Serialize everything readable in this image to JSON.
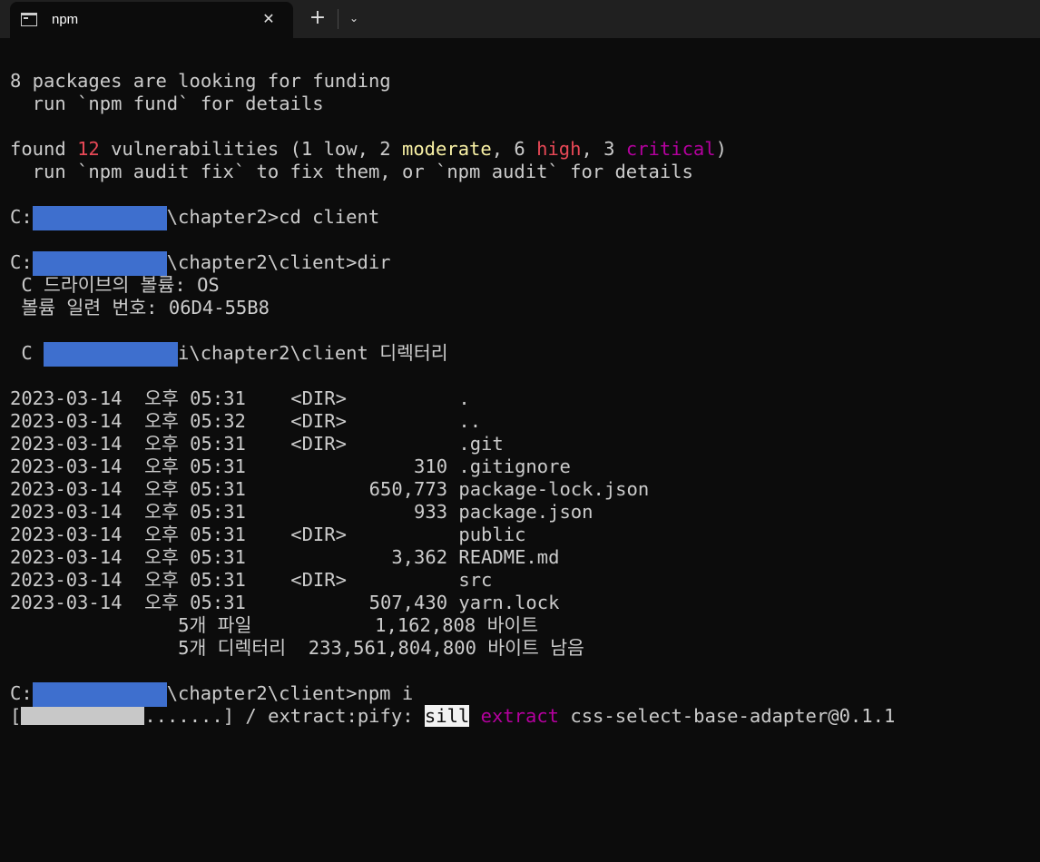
{
  "tab": {
    "title": "npm",
    "close_glyph": "✕",
    "new_tab_glyph": "+",
    "dropdown_glyph": "⌄"
  },
  "colors": {
    "background": "#0c0c0c",
    "foreground": "#cccccc",
    "red": "#e74856",
    "yellow": "#f9f1a5",
    "magenta": "#b4009e",
    "redaction": "#3e6fce"
  },
  "icons": {
    "tab": "terminal-icon",
    "close": "close-icon",
    "new_tab": "plus-icon",
    "dropdown": "chevron-down-icon"
  },
  "funding": {
    "line1": "8 packages are looking for funding",
    "line2": "  run `npm fund` for details"
  },
  "vuln": {
    "pre": "found ",
    "count": "12",
    "mid1": " vulnerabilities (1 low, 2 ",
    "moderate": "moderate",
    "mid2": ", 6 ",
    "high": "high",
    "mid3": ", 3 ",
    "critical": "critical",
    "post": ")",
    "fix": "  run `npm audit fix` to fix them, or `npm audit` for details"
  },
  "cmds": [
    {
      "prefix": "C:",
      "suffix": "\\chapter2>cd client"
    },
    {
      "prefix": "C:",
      "suffix": "\\chapter2\\client>dir"
    },
    {
      "prefix": " C ",
      "suffix": "i\\chapter2\\client 디렉터리"
    },
    {
      "prefix": "C:",
      "suffix": "\\chapter2\\client>npm i"
    }
  ],
  "volume": {
    "line1": " C 드라이브의 볼륨: OS",
    "line2": " 볼륨 일련 번호: 06D4-55B8"
  },
  "listing": [
    "2023-03-14  오후 05:31    <DIR>          .",
    "2023-03-14  오후 05:32    <DIR>          ..",
    "2023-03-14  오후 05:31    <DIR>          .git",
    "2023-03-14  오후 05:31               310 .gitignore",
    "2023-03-14  오후 05:31           650,773 package-lock.json",
    "2023-03-14  오후 05:31               933 package.json",
    "2023-03-14  오후 05:31    <DIR>          public",
    "2023-03-14  오후 05:31             3,362 README.md",
    "2023-03-14  오후 05:31    <DIR>          src",
    "2023-03-14  오후 05:31           507,430 yarn.lock"
  ],
  "summary": {
    "files": "               5개 파일           1,162,808 바이트",
    "dirs": "               5개 디렉터리  233,561,804,800 바이트 남음"
  },
  "progress": {
    "open": "[",
    "dots": ".......] / extract:pify: ",
    "level": "sill",
    "space": " ",
    "action": "extract",
    "target": " css-select-base-adapter@0.1.1"
  }
}
